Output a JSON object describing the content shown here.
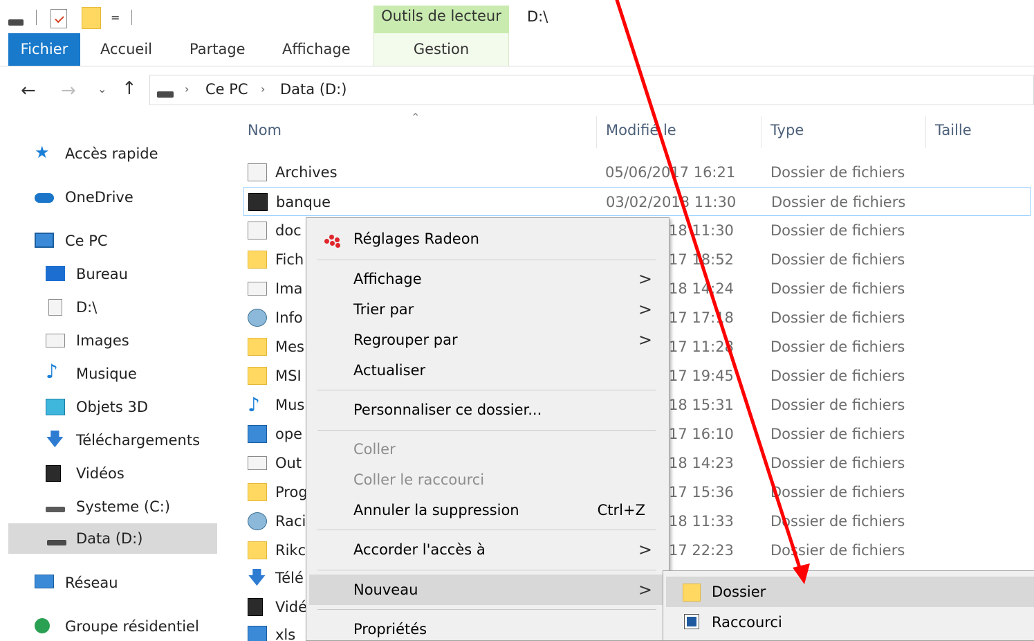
{
  "title_bar": {
    "tools_tab": "Outils de lecteur",
    "path": "D:\\",
    "dropdown_glyph": "="
  },
  "ribbon": {
    "tabs": [
      {
        "label": "Fichier"
      },
      {
        "label": "Accueil"
      },
      {
        "label": "Partage"
      },
      {
        "label": "Affichage"
      },
      {
        "label": "Gestion"
      }
    ],
    "active_color": "#1979ca",
    "contextual_color": "#c9ebb0"
  },
  "address_bar": {
    "crumbs": [
      "Ce PC",
      "Data (D:)"
    ],
    "separator": "›"
  },
  "nav_pane": {
    "items": [
      {
        "label": "Accès rapide",
        "icon": "star-icon"
      },
      {
        "label": "OneDrive",
        "icon": "cloud-icon"
      },
      {
        "label": "Ce PC",
        "icon": "computer-icon"
      },
      {
        "label": "Bureau",
        "icon": "desktop-icon"
      },
      {
        "label": "D:\\",
        "icon": "document-icon"
      },
      {
        "label": "Images",
        "icon": "images-icon"
      },
      {
        "label": "Musique",
        "icon": "music-icon"
      },
      {
        "label": "Objets 3D",
        "icon": "cube-icon"
      },
      {
        "label": "Téléchargements",
        "icon": "download-icon"
      },
      {
        "label": "Vidéos",
        "icon": "video-icon"
      },
      {
        "label": "Systeme (C:)",
        "icon": "drive-c-icon"
      },
      {
        "label": "Data (D:)",
        "icon": "drive-d-icon",
        "selected": true
      },
      {
        "label": "Réseau",
        "icon": "network-icon"
      },
      {
        "label": "Groupe résidentiel",
        "icon": "homegroup-icon"
      }
    ]
  },
  "columns": [
    "Nom",
    "Modifié le",
    "Type",
    "Taille"
  ],
  "files": [
    {
      "name": "Archives",
      "date": "05/06/2017 16:21",
      "type": "Dossier de fichiers",
      "icon": "archive-icon"
    },
    {
      "name": "banque",
      "date": "03/02/2018 11:30",
      "type": "Dossier de fichiers",
      "icon": "bank-icon",
      "selected": true
    },
    {
      "name": "doc",
      "date": "18 11:30",
      "type": "Dossier de fichiers",
      "icon": "doc-folder-icon"
    },
    {
      "name": "Fich",
      "date": "17 18:52",
      "type": "Dossier de fichiers",
      "icon": "folder-icon"
    },
    {
      "name": "Ima",
      "date": "18 14:24",
      "type": "Dossier de fichiers",
      "icon": "images-folder-icon"
    },
    {
      "name": "Info",
      "date": "17 17:18",
      "type": "Dossier de fichiers",
      "icon": "info-folder-icon"
    },
    {
      "name": "Mes",
      "date": "17 11:28",
      "type": "Dossier de fichiers",
      "icon": "mes-folder-icon"
    },
    {
      "name": "MSI",
      "date": "17 19:45",
      "type": "Dossier de fichiers",
      "icon": "folder-icon"
    },
    {
      "name": "Mus",
      "date": "18 15:31",
      "type": "Dossier de fichiers",
      "icon": "music-folder-icon"
    },
    {
      "name": "ope",
      "date": "17 16:10",
      "type": "Dossier de fichiers",
      "icon": "ope-folder-icon"
    },
    {
      "name": "Out",
      "date": "18 14:23",
      "type": "Dossier de fichiers",
      "icon": "outlook-folder-icon"
    },
    {
      "name": "Prog",
      "date": "17 15:36",
      "type": "Dossier de fichiers",
      "icon": "folder-icon"
    },
    {
      "name": "Raci",
      "date": "18 11:33",
      "type": "Dossier de fichiers",
      "icon": "raci-folder-icon"
    },
    {
      "name": "Rikc",
      "date": "17 22:23",
      "type": "Dossier de fichiers",
      "icon": "folder-icon"
    },
    {
      "name": "Télé",
      "date": "",
      "type": "",
      "icon": "download-folder-icon"
    },
    {
      "name": "Vidé",
      "date": "",
      "type": "",
      "icon": "video-folder-icon"
    },
    {
      "name": "xls",
      "date": "",
      "type": "",
      "icon": "xls-folder-icon"
    }
  ],
  "context_menu": {
    "items": [
      {
        "label": "Réglages Radeon",
        "icon": "radeon-icon"
      },
      {
        "label": "Affichage",
        "submenu": true
      },
      {
        "label": "Trier par",
        "submenu": true
      },
      {
        "label": "Regrouper par",
        "submenu": true
      },
      {
        "label": "Actualiser"
      },
      {
        "label": "Personnaliser ce dossier..."
      },
      {
        "label": "Coller",
        "disabled": true
      },
      {
        "label": "Coller le raccourci",
        "disabled": true
      },
      {
        "label": "Annuler la suppression",
        "shortcut": "Ctrl+Z"
      },
      {
        "label": "Accorder l'accès à",
        "submenu": true
      },
      {
        "label": "Nouveau",
        "submenu": true,
        "highlighted": true
      },
      {
        "label": "Propriétés"
      }
    ],
    "arrow_glyph": ">"
  },
  "submenu": {
    "items": [
      {
        "label": "Dossier",
        "icon": "folder-icon",
        "highlighted": true
      },
      {
        "label": "Raccourci",
        "icon": "shortcut-icon"
      }
    ]
  },
  "annotation": {
    "color": "#ff0000"
  }
}
